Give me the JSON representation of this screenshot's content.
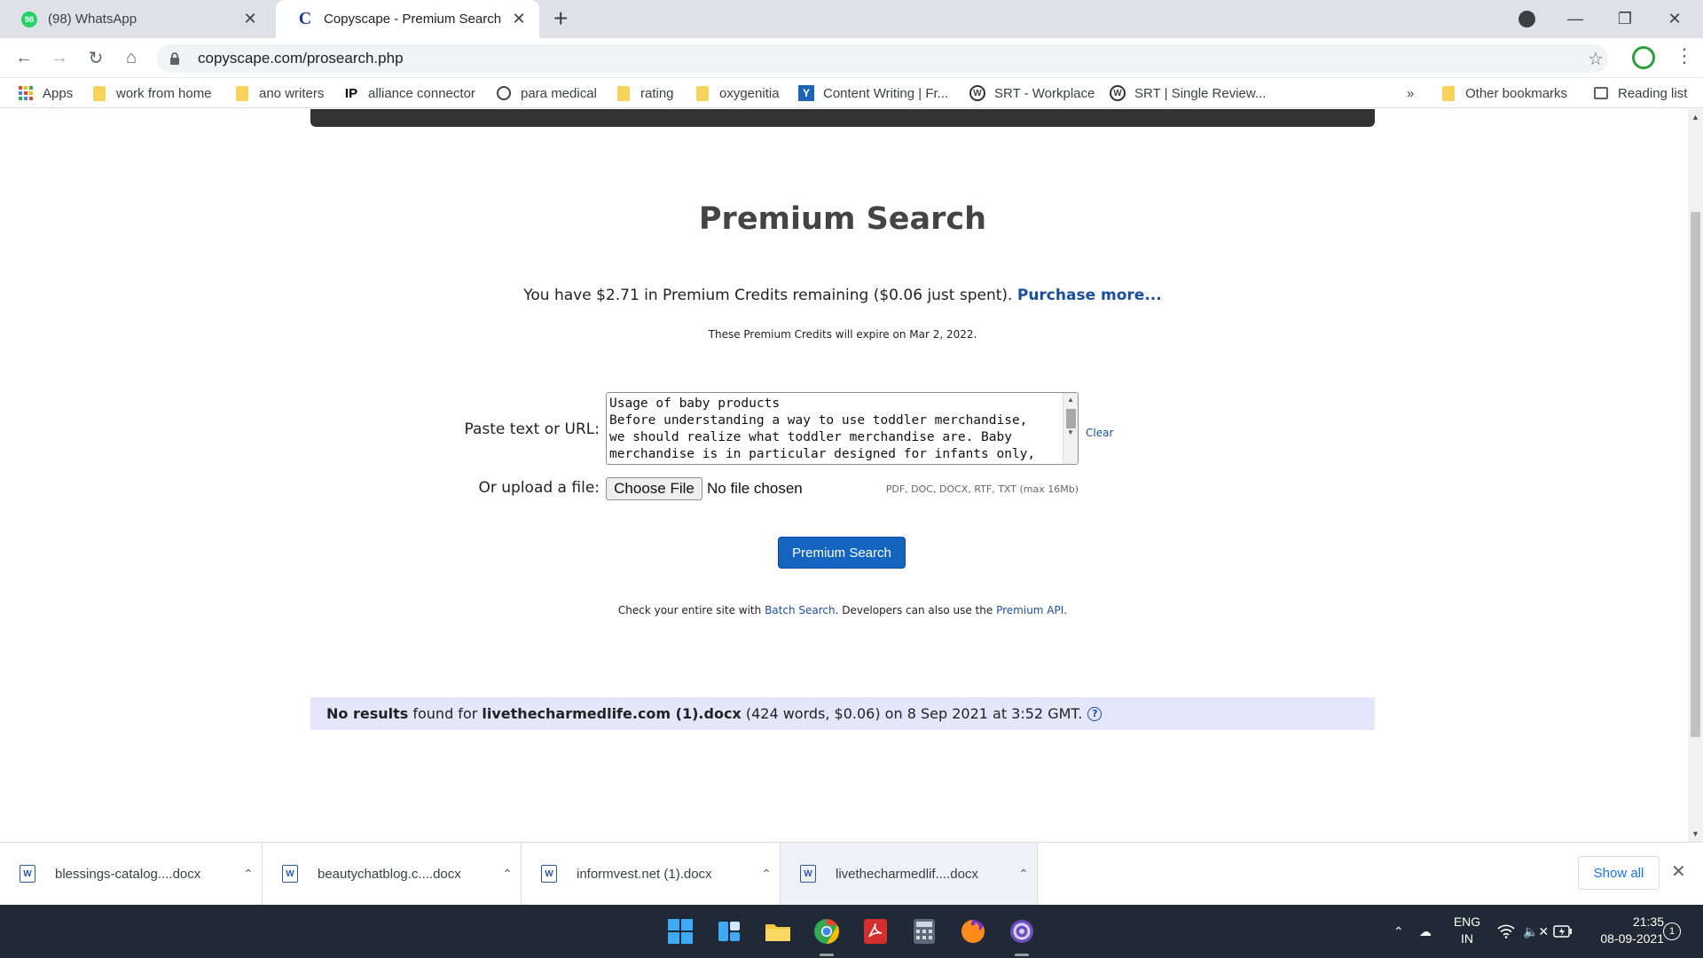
{
  "browser": {
    "tabs": [
      {
        "title": "(98) WhatsApp",
        "badge": "98",
        "active": false
      },
      {
        "title": "Copyscape - Premium Search",
        "active": true
      }
    ],
    "url": "copyscape.com/prosearch.php",
    "bookmarks": [
      {
        "label": "Apps",
        "icon": "apps-grid-icon"
      },
      {
        "label": "work from home",
        "icon": "folder-icon"
      },
      {
        "label": "ano writers",
        "icon": "folder-icon"
      },
      {
        "label": "alliance connector",
        "icon": "ip-logo-icon"
      },
      {
        "label": "para medical",
        "icon": "globe-icon"
      },
      {
        "label": "rating",
        "icon": "folder-icon"
      },
      {
        "label": "oxygenitia",
        "icon": "folder-icon"
      },
      {
        "label": "Content Writing | Fr...",
        "icon": "content-writing-icon"
      },
      {
        "label": "SRT - Workplace",
        "icon": "wordpress-icon"
      },
      {
        "label": "SRT | Single Review...",
        "icon": "wordpress-icon"
      }
    ],
    "overflow_label": "»",
    "other_bookmarks": "Other bookmarks",
    "reading_list": "Reading list"
  },
  "page": {
    "title": "Premium Search",
    "credits_text": "You have $2.71 in Premium Credits remaining ($0.06 just spent).",
    "purchase_link": "Purchase more...",
    "expire_text": "These Premium Credits will expire on Mar 2, 2022.",
    "paste_label": "Paste text or URL:",
    "paste_value": "Usage of baby products\nBefore understanding a way to use toddler merchandise,\nwe should realize what toddler merchandise are. Baby\nmerchandise is in particular designed for infants only,",
    "clear_link": "Clear",
    "upload_label": "Or upload a file:",
    "choose_file_button": "Choose File",
    "no_file_text": "No file chosen",
    "formats_text": "PDF, DOC, DOCX, RTF, TXT (max 16Mb)",
    "search_button": "Premium Search",
    "batch_prefix": "Check your entire site with",
    "batch_link": "Batch Search",
    "batch_middle": ". Developers can also use the",
    "api_link": "Premium API",
    "batch_suffix": ".",
    "result": {
      "lead": "No results",
      "found_for": "found for",
      "filename": "livethecharmedlife.com (1).docx",
      "details": "(424 words, $0.06) on 8 Sep 2021 at 3:52 GMT.",
      "help_icon": "?"
    }
  },
  "downloads": {
    "items": [
      {
        "name": "blessings-catalog....docx"
      },
      {
        "name": "beautychatblog.c....docx"
      },
      {
        "name": "informvest.net (1).docx"
      },
      {
        "name": "livethecharmedlif....docx"
      }
    ],
    "show_all": "Show all"
  },
  "taskbar": {
    "language_top": "ENG",
    "language_bottom": "IN",
    "time": "21:35",
    "date": "08-09-2021",
    "notification_count": "1"
  }
}
